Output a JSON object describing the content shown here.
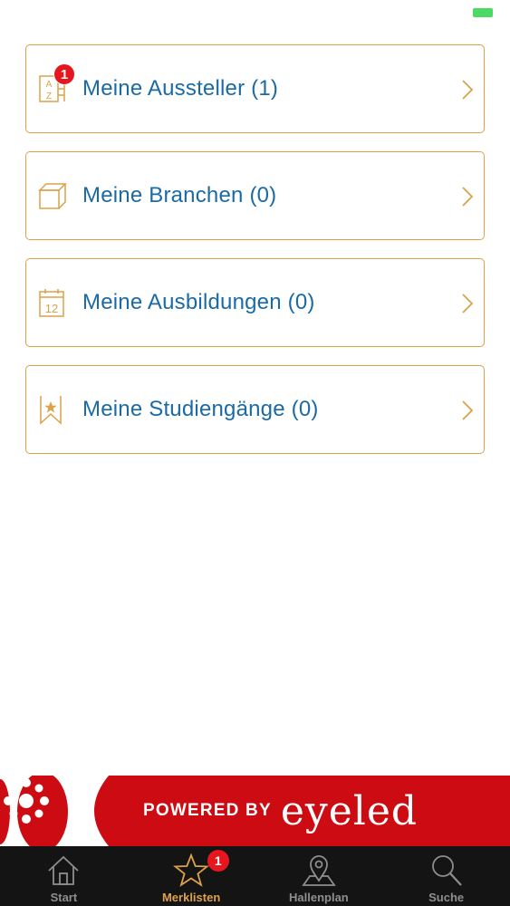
{
  "colors": {
    "accent": "#dca24a",
    "label": "#1a6aa6",
    "badge": "#e5161e",
    "banner": "#cc0c12",
    "tabbar": "#141414",
    "battery": "#4cd964"
  },
  "lists": [
    {
      "label": "Meine Aussteller (1)",
      "icon": "a-z-list-icon",
      "badge": "1"
    },
    {
      "label": "Meine Branchen (0)",
      "icon": "box-icon"
    },
    {
      "label": "Meine Ausbildungen (0)",
      "icon": "calendar-icon",
      "icon_text": "12"
    },
    {
      "label": "Meine Studiengänge (0)",
      "icon": "bookmark-star-icon"
    }
  ],
  "banner": {
    "powered_by": "POWERED BY",
    "brand": "eyeled"
  },
  "tabs": [
    {
      "label": "Start",
      "icon": "home-icon",
      "active": false
    },
    {
      "label": "Merklisten",
      "icon": "star-icon",
      "active": true,
      "badge": "1"
    },
    {
      "label": "Hallenplan",
      "icon": "map-pin-icon",
      "active": false
    },
    {
      "label": "Suche",
      "icon": "search-icon",
      "active": false
    }
  ]
}
